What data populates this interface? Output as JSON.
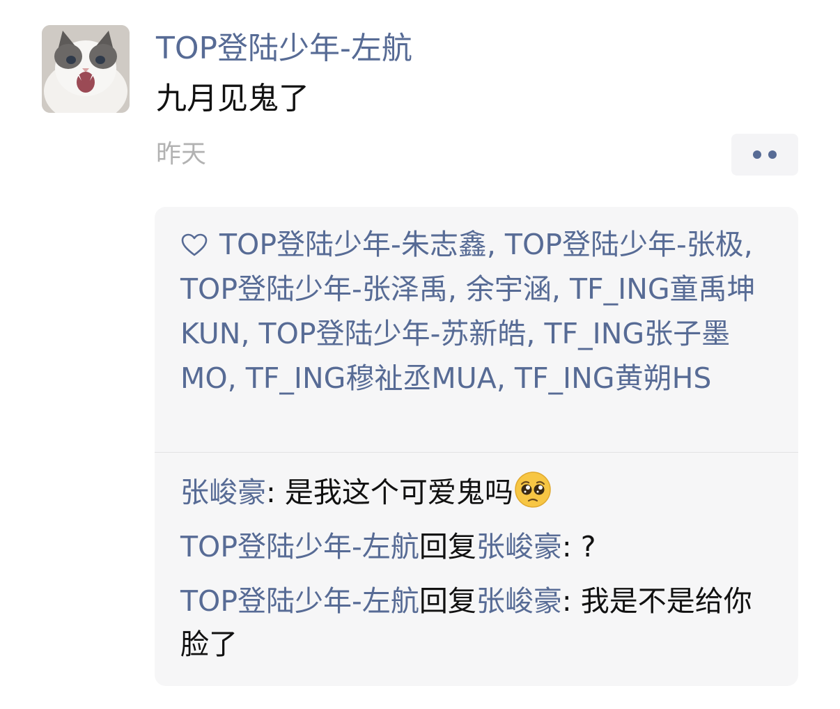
{
  "post": {
    "author": "TOP登陆少年-左航",
    "content": "九月见鬼了",
    "time": "昨天",
    "avatar_icon": "cat-avatar"
  },
  "more_button": {
    "icon": "dots-icon"
  },
  "likes": {
    "icon": "heart-outline-icon",
    "names": [
      "TOP登陆少年-朱志鑫",
      "TOP登陆少年-张极",
      "TOP登陆少年-张泽禹",
      "余宇涵",
      "TF_ING童禹坤KUN",
      "TOP登陆少年-苏新皓",
      "TF_ING张子墨MO",
      "TF_ING穆祉丞MUA",
      "TF_ING黄朔HS"
    ],
    "separator": ", "
  },
  "comments": [
    {
      "author": "张峻豪",
      "colon": ": ",
      "text": "是我这个可爱鬼吗",
      "emoji": "pleading-face-emoji"
    },
    {
      "author": "TOP登陆少年-左航",
      "reply_word": "回复",
      "reply_to": "张峻豪",
      "colon": ": ",
      "text": "?"
    },
    {
      "author": "TOP登陆少年-左航",
      "reply_word": "回复",
      "reply_to": "张峻豪",
      "colon": ": ",
      "text": "我是不是给你脸了"
    }
  ],
  "colors": {
    "link": "#576b95",
    "text": "#111111",
    "muted": "#b2b2b2",
    "panel": "#f6f6f7"
  }
}
